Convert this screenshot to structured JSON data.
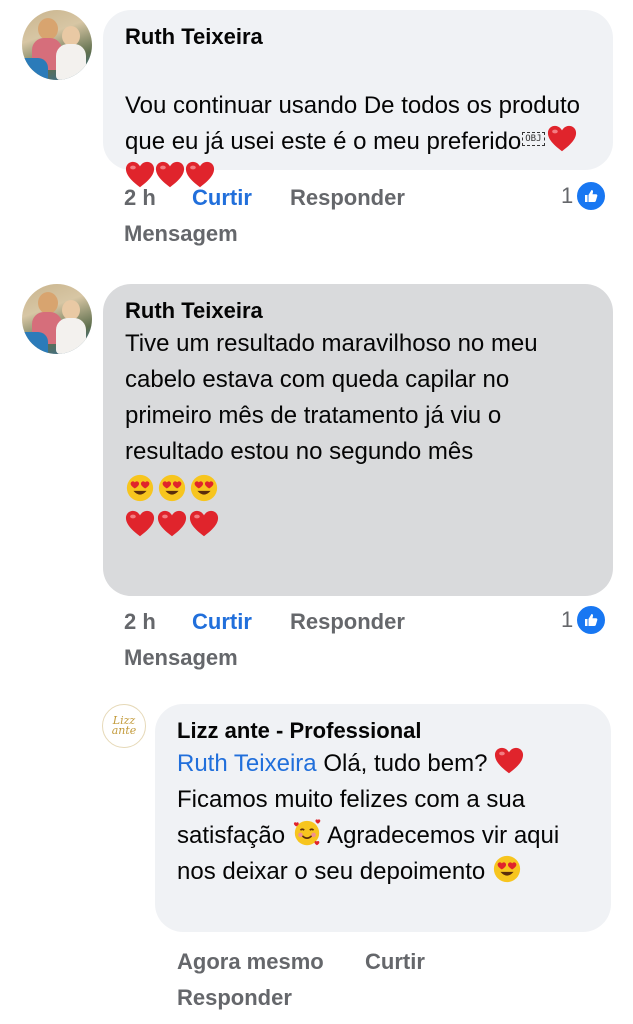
{
  "comments": [
    {
      "author": "Ruth Teixeira",
      "text": "Vou continuar usando De todos os produto que eu já usei este é o meu preferido",
      "obj_placeholder": "OBJ",
      "emojis": [
        "❤️",
        "❤️",
        "❤️",
        "❤️"
      ],
      "time": "2 h",
      "like_label": "Curtir",
      "reply_label": "Responder",
      "message_label": "Mensagem",
      "reaction_count": "1",
      "reaction_icon": "like-icon"
    },
    {
      "author": "Ruth Teixeira",
      "text": "Tive um resultado maravilhoso no meu cabelo estava com queda capilar no primeiro mês de tratamento já viu o resultado estou no segundo mês",
      "emoji_row_1": [
        "😍",
        "😍",
        "😍"
      ],
      "emoji_row_2": [
        "❤️",
        "❤️",
        "❤️"
      ],
      "time": "2 h",
      "like_label": "Curtir",
      "reply_label": "Responder",
      "message_label": "Mensagem",
      "reaction_count": "1",
      "reaction_icon": "like-icon"
    }
  ],
  "reply": {
    "author": "Lizz ante - Professional",
    "page_logo_text": [
      "Lizz",
      "ante"
    ],
    "mention": "Ruth Teixeira",
    "text_part_1": "Olá, tudo bem?",
    "text_part_2": "Ficamos muito felizes com a sua satisfação",
    "text_part_3": "Agradecemos vir aqui nos deixar o seu depoimento",
    "time": "Agora mesmo",
    "like_label": "Curtir",
    "reply_label": "Responder"
  },
  "colors": {
    "bubble_bg": "#f0f2f5",
    "bubble_pressed_bg": "#d9dadc",
    "link_blue": "#216fdb",
    "muted_text": "#65676b",
    "heart_red": "#e0242c",
    "like_blue": "#1877f2"
  }
}
